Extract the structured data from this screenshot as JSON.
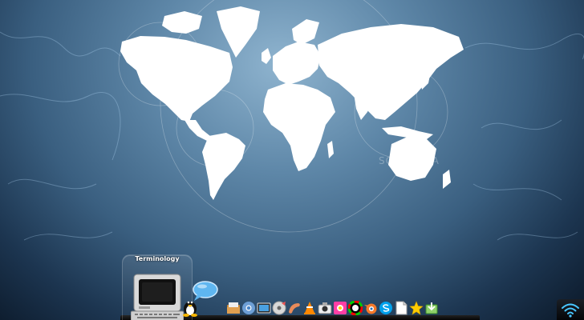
{
  "dock": {
    "active_app": {
      "label": "Terminology",
      "icon": "terminal-computer-icon"
    },
    "launchers": [
      {
        "icon": "tux-penguin-icon"
      },
      {
        "icon": "chat-bubble-icon"
      },
      {
        "icon": "file-manager-icon"
      },
      {
        "icon": "chromium-browser-icon"
      },
      {
        "icon": "screenshot-icon"
      },
      {
        "icon": "disc-burner-icon"
      },
      {
        "icon": "sausage-app-icon"
      },
      {
        "icon": "vlc-cone-icon"
      },
      {
        "icon": "camera-icon"
      },
      {
        "icon": "flower-app-icon"
      },
      {
        "icon": "color-wheel-icon"
      },
      {
        "icon": "blender-icon"
      },
      {
        "icon": "skype-icon"
      },
      {
        "icon": "document-icon"
      },
      {
        "icon": "star-icon"
      },
      {
        "icon": "package-installer-icon"
      }
    ]
  },
  "tray": {
    "icon": "wifi-icon"
  },
  "wallpaper": {
    "watermark": "SOFTPEDIA"
  }
}
